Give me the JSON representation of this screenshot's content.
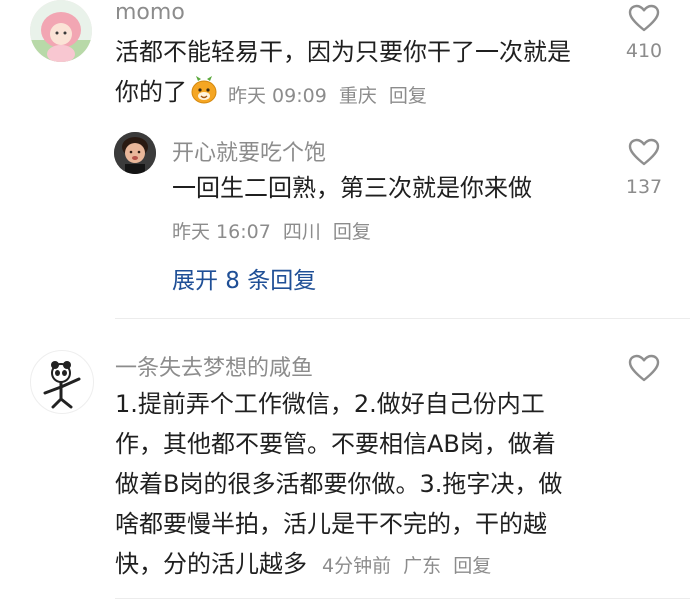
{
  "comments": [
    {
      "username": "momo",
      "text_lines": [
        "活都不能轻易干，因为只要你干了一次就是",
        "你的了"
      ],
      "meta": {
        "time": "昨天 09:09",
        "location": "重庆",
        "reply_label": "回复"
      },
      "like_count": "410",
      "replies": [
        {
          "username": "开心就要吃个饱",
          "text": "一回生二回熟，第三次就是你来做",
          "meta": {
            "time": "昨天 16:07",
            "location": "四川",
            "reply_label": "回复"
          },
          "like_count": "137"
        }
      ],
      "expand_label": "展开 8 条回复"
    },
    {
      "username": "一条失去梦想的咸鱼",
      "text_lines": [
        "1.提前弄个工作微信，2.做好自己份内工",
        "作，其他都不要管。不要相信AB岗，做着",
        "做着B岗的很多活都要你做。3.拖字决，做",
        "啥都要慢半拍，活儿是干不完的，干的越",
        "快，分的活儿越多"
      ],
      "meta": {
        "time": "4分钟前",
        "location": "广东",
        "reply_label": "回复"
      },
      "like_count": ""
    }
  ],
  "icons": {
    "like": "heart-outline-icon",
    "emoji": "cartoon-face-emoji"
  },
  "colors": {
    "text": "#1f1f1f",
    "secondary": "#8c8c8c",
    "link": "#1f4f96",
    "divider": "#ececec"
  }
}
